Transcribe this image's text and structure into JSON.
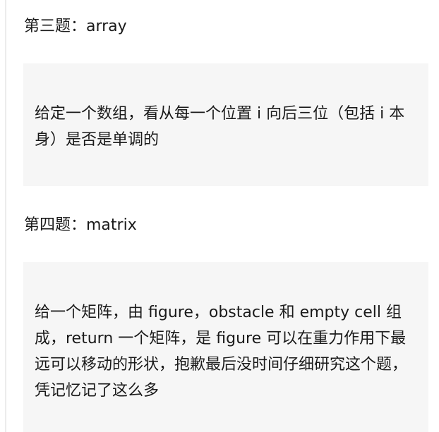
{
  "sections": [
    {
      "heading": "第三题：array",
      "quote": "给定一个数组，看从每一个位置 i 向后三位（包括 i 本身）是否是单调的"
    },
    {
      "heading": "第四题：matrix",
      "quote": "给一个矩阵，由 figure，obstacle 和 empty cell 组成，return 一个矩阵，是 figure 可以在重力作用下最远可以移动的形状，抱歉最后没时间仔细研究这个题，凭记忆记了这么多"
    }
  ]
}
